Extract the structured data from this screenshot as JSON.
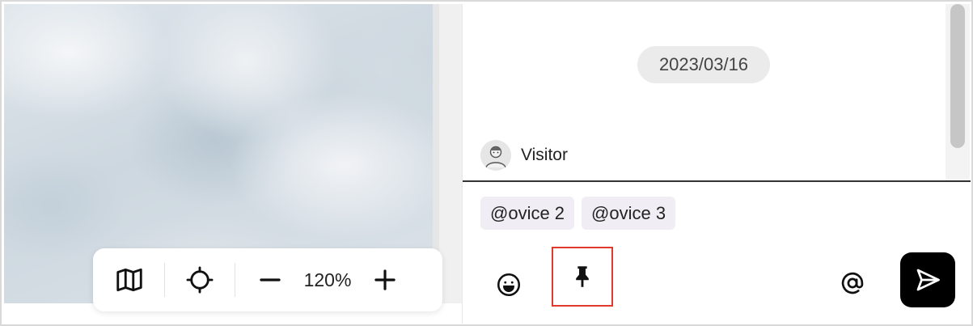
{
  "map": {
    "toolbar": {
      "map_icon": "map-icon",
      "locate_icon": "crosshair-icon",
      "zoom_out_icon": "minus-icon",
      "zoom_level": "120%",
      "zoom_in_icon": "plus-icon"
    }
  },
  "chat": {
    "date": "2023/03/16",
    "sender": {
      "name": "Visitor",
      "avatar_icon": "avatar-icon"
    },
    "mentions": [
      "@ovice 2",
      "@ovice 3"
    ],
    "actions": {
      "emoji_icon": "emoji-icon",
      "pin_icon": "pin-icon",
      "mention_icon": "at-icon",
      "send_icon": "send-icon"
    },
    "highlight_color": "#e03a2f",
    "send_button_color": "#000000"
  }
}
